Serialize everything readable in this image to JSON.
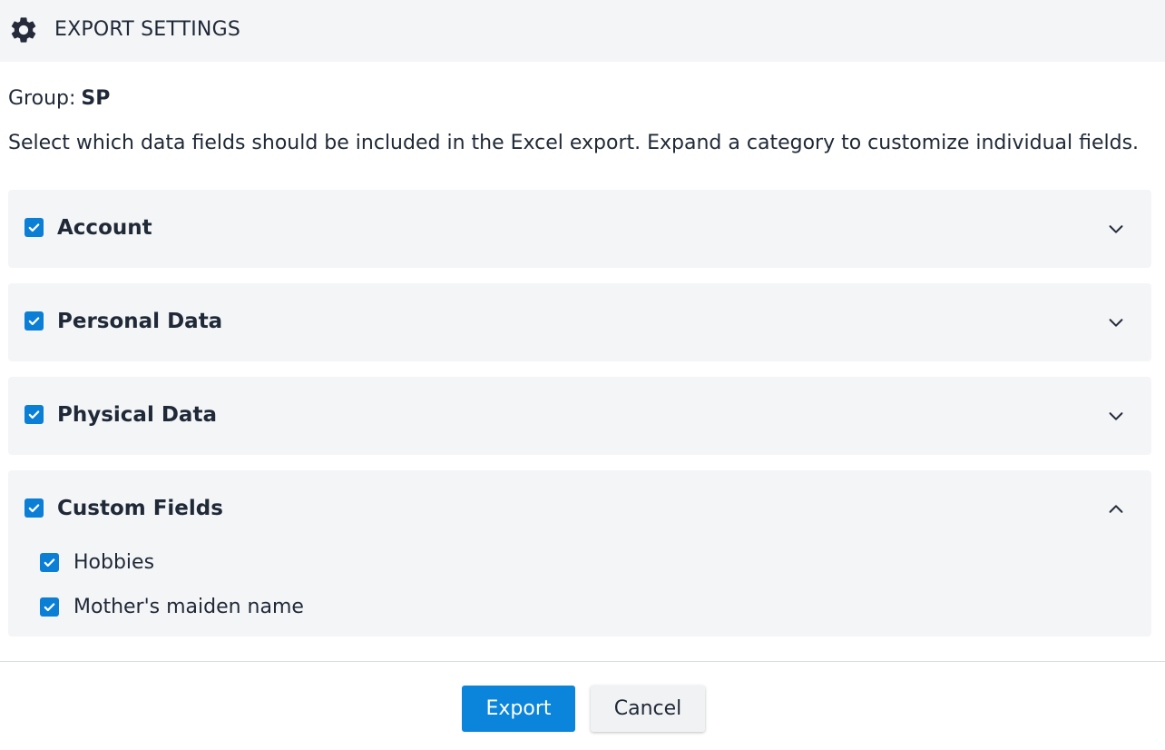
{
  "header": {
    "title": "EXPORT SETTINGS",
    "icon": "gear-icon"
  },
  "group": {
    "label": "Group:",
    "value": "SP"
  },
  "description": "Select which data fields should be included in the Excel export. Expand a category to customize individual fields.",
  "categories": [
    {
      "label": "Account",
      "checked": true,
      "expanded": false
    },
    {
      "label": "Personal Data",
      "checked": true,
      "expanded": false
    },
    {
      "label": "Physical Data",
      "checked": true,
      "expanded": false
    },
    {
      "label": "Custom Fields",
      "checked": true,
      "expanded": true,
      "fields": [
        {
          "label": "Hobbies",
          "checked": true
        },
        {
          "label": "Mother's maiden name",
          "checked": true
        }
      ]
    }
  ],
  "buttons": {
    "export": "Export",
    "cancel": "Cancel"
  },
  "colors": {
    "accent": "#0b84db",
    "panel_bg": "#f4f5f7",
    "text": "#1f2937"
  }
}
